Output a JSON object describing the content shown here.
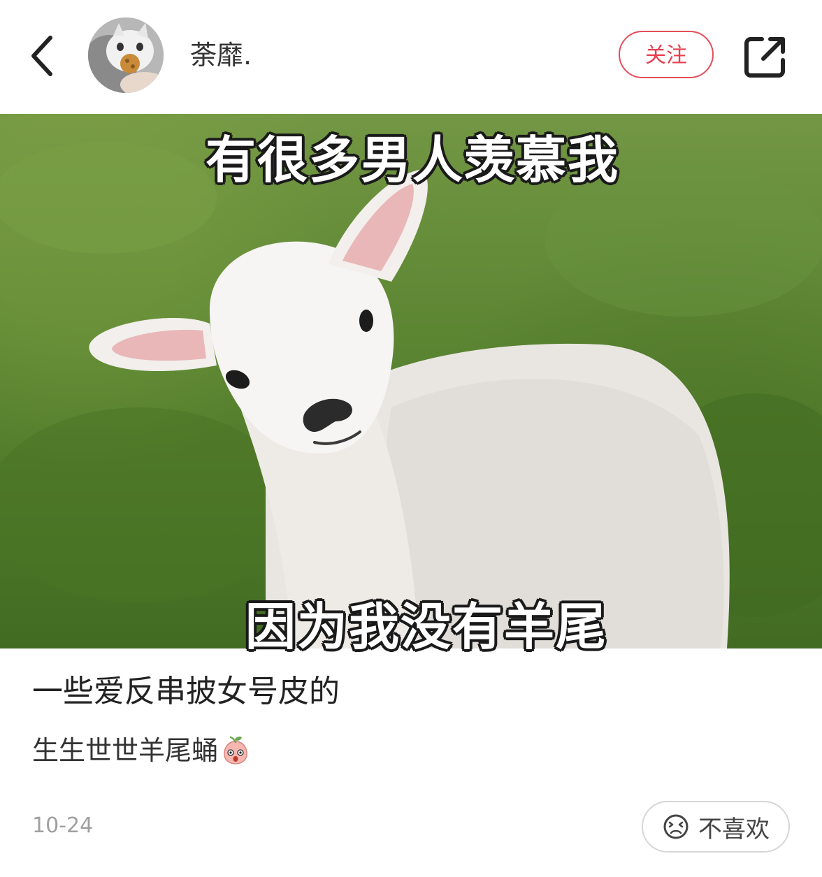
{
  "header": {
    "username": "荼靡.",
    "follow_label": "关注"
  },
  "image": {
    "caption_top": "有很多男人羡慕我",
    "caption_bottom": "因为我没有羊尾"
  },
  "post": {
    "title": "一些爱反串披女号皮的",
    "body": "生生世世羊尾蛹",
    "date": "10-24"
  },
  "actions": {
    "dislike_label": "不喜欢"
  },
  "colors": {
    "accent": "#e63f4f",
    "muted": "#a0a0a0",
    "grass": "#5d8633"
  },
  "icons": {
    "back": "chevron-left-icon",
    "share": "share-external-icon",
    "dislike": "unhappy-face-icon",
    "emoji": "peach-face-emoji"
  }
}
